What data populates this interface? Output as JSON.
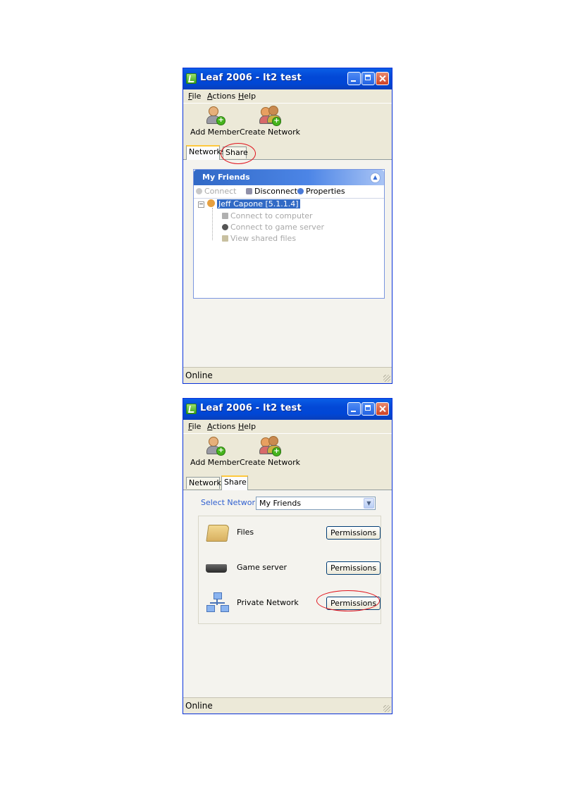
{
  "windows": [
    {
      "title": "Leaf 2006 - lt2 test",
      "menu": [
        "File",
        "Actions",
        "Help"
      ],
      "toolbar": {
        "add_member": "Add Member",
        "create_network": "Create Network"
      },
      "tabs": [
        "Networks",
        "Share"
      ],
      "active_tab": "Networks",
      "panel": {
        "title": "My Friends",
        "actions": {
          "connect": "Connect",
          "disconnect": "Disconnect",
          "properties": "Properties"
        },
        "member": "Jeff Capone [5.1.1.4]",
        "children": [
          "Connect to computer",
          "Connect to game server",
          "View shared files"
        ]
      },
      "status": "Online"
    },
    {
      "title": "Leaf 2006 - lt2 test",
      "menu": [
        "File",
        "Actions",
        "Help"
      ],
      "toolbar": {
        "add_member": "Add Member",
        "create_network": "Create Network"
      },
      "tabs": [
        "Networks",
        "Share"
      ],
      "active_tab": "Share",
      "share": {
        "select_label": "Select Network",
        "selected_network": "My Friends",
        "rows": [
          {
            "label": "Files",
            "button": "Permissions"
          },
          {
            "label": "Game server",
            "button": "Permissions"
          },
          {
            "label": "Private Network",
            "button": "Permissions"
          }
        ]
      },
      "status": "Online"
    }
  ],
  "colors": {
    "annotation": "#e0141e",
    "titlebar": "#0348d6",
    "window_bg": "#ece9d8"
  }
}
